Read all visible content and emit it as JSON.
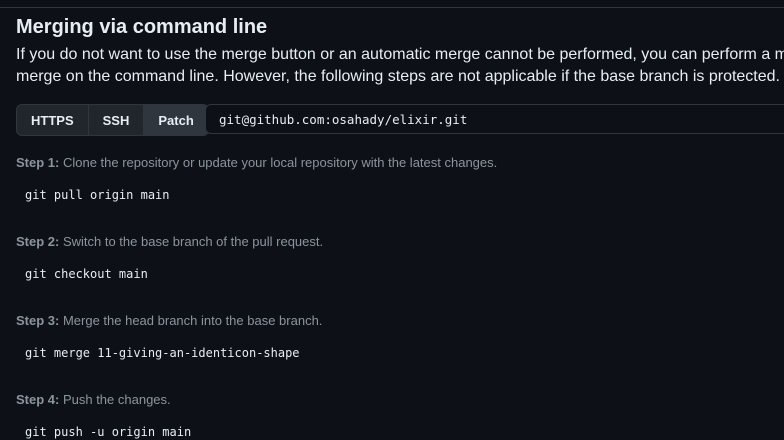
{
  "section": {
    "title": "Merging via command line",
    "description_line1": "If you do not want to use the merge button or an automatic merge cannot be performed, you can perform a manual",
    "description_line2": "merge on the command line. However, the following steps are not applicable if the base branch is protected."
  },
  "protocols": {
    "items": [
      {
        "label": "HTTPS",
        "selected": false
      },
      {
        "label": "SSH",
        "selected": false
      },
      {
        "label": "Patch",
        "selected": true
      }
    ],
    "url_value": "git@github.com:osahady/elixir.git"
  },
  "steps": [
    {
      "label": "Step 1:",
      "text": " Clone the repository or update your local repository with the latest changes.",
      "command": "git pull origin main"
    },
    {
      "label": "Step 2:",
      "text": " Switch to the base branch of the pull request.",
      "command": "git checkout main"
    },
    {
      "label": "Step 3:",
      "text": " Merge the head branch into the base branch.",
      "command": "git merge 11-giving-an-identicon-shape"
    },
    {
      "label": "Step 4:",
      "text": " Push the changes.",
      "command": "git push -u origin main"
    }
  ]
}
